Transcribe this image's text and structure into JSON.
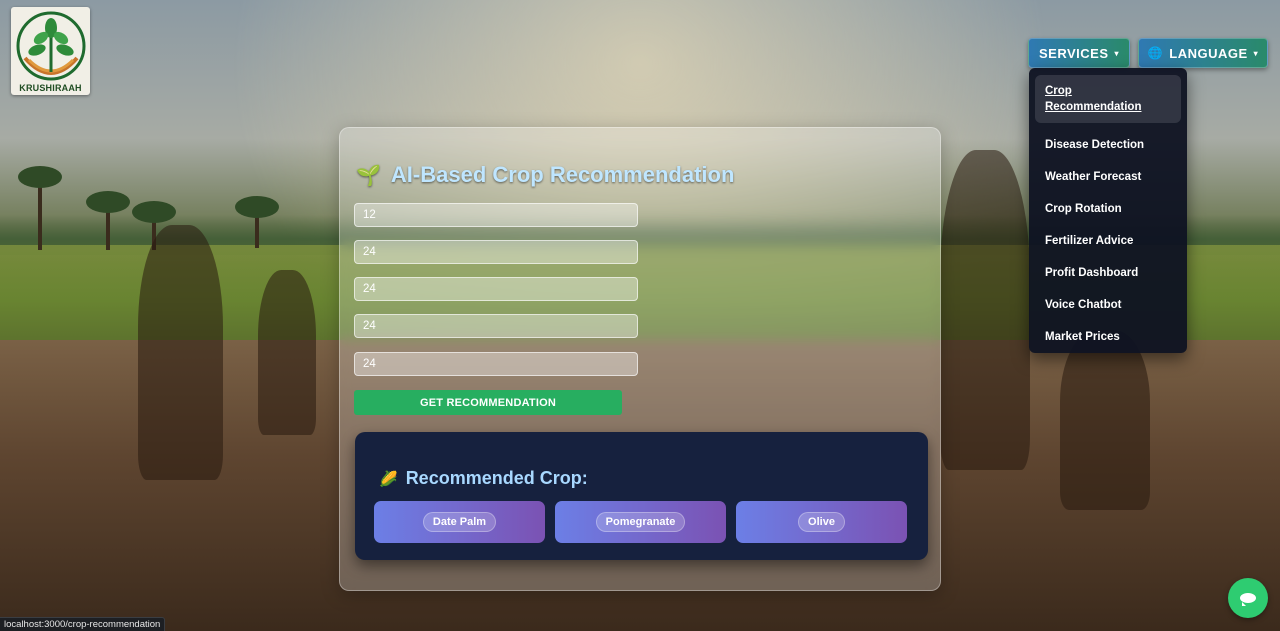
{
  "brand": {
    "name": "KRUSHIRAAH",
    "logo_icon": "leaf-sprout-logo"
  },
  "nav": {
    "services_label": "SERVICES",
    "language_label": "LANGUAGE",
    "caret": "▾",
    "globe_icon": "🌐"
  },
  "services_menu": {
    "items": [
      {
        "label": "Crop Recommendation",
        "active": true
      },
      {
        "label": "Disease Detection"
      },
      {
        "label": "Weather Forecast"
      },
      {
        "label": "Crop Rotation"
      },
      {
        "label": "Fertilizer Advice"
      },
      {
        "label": "Profit Dashboard"
      },
      {
        "label": "Voice Chatbot"
      },
      {
        "label": "Market Prices"
      }
    ]
  },
  "form": {
    "title": "AI-Based Crop Recommendation",
    "title_icon": "🌱",
    "inputs": [
      "12",
      "24",
      "24",
      "24",
      "24"
    ],
    "submit_label": "GET RECOMMENDATION"
  },
  "result": {
    "title": "Recommended Crop:",
    "title_icon": "🌽",
    "crops": [
      "Date Palm",
      "Pomegranate",
      "Olive"
    ]
  },
  "status_bar": {
    "url": "localhost:3000/crop-recommendation"
  },
  "colors": {
    "accent_green": "#27ae60",
    "nav_gradient_start": "#2f79b3",
    "panel_dark": "#16213e",
    "crop_gradient_start": "#6c7fe6",
    "crop_gradient_end": "#7b52b3"
  }
}
